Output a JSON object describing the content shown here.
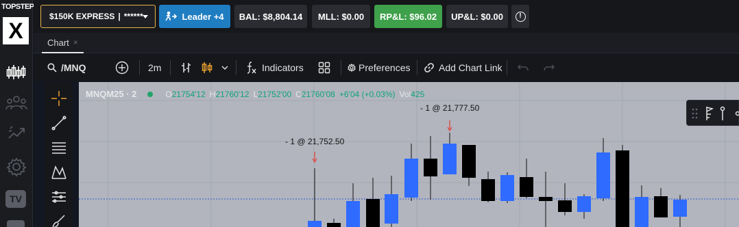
{
  "brand": {
    "logo_text": "TOPSTEP",
    "logo_mark": "X"
  },
  "rail": {
    "tv_label": "TV"
  },
  "account": {
    "name": "$150K EXPRESS",
    "masked": "******"
  },
  "topbar": {
    "leader": "Leader +4",
    "bal": "BAL: $8,804.14",
    "mll": "MLL: $0.00",
    "rpl": "RP&L: $96.02",
    "upl": "UP&L: $0.00",
    "info": "!"
  },
  "tabs": [
    {
      "label": "Chart",
      "close": "×"
    }
  ],
  "toolbar": {
    "symbol": "/MNQ",
    "interval": "2m",
    "indicators": "Indicators",
    "preferences": "Preferences",
    "add_chart_link": "Add Chart Link"
  },
  "chart_legend": {
    "symbol": "MNQM25 · 2",
    "o_label": "O",
    "o": "21754'12",
    "h_label": "H",
    "h": "21760'12",
    "l_label": "L",
    "l": "21752'00",
    "c_label": "C",
    "c": "21760'08",
    "change": "+6'04 (+0.03%)",
    "vol_label": "Vol",
    "vol": "425"
  },
  "trade_markers": [
    {
      "label": "- 1 @ 21,752.50"
    },
    {
      "label": "- 1 @ 21,777.50"
    }
  ],
  "colors": {
    "up": "#2f6bff",
    "down": "#000000",
    "accent": "#e8b54a",
    "rpl_bg": "#3fa14b",
    "leader_bg": "#1f7dc2"
  }
}
